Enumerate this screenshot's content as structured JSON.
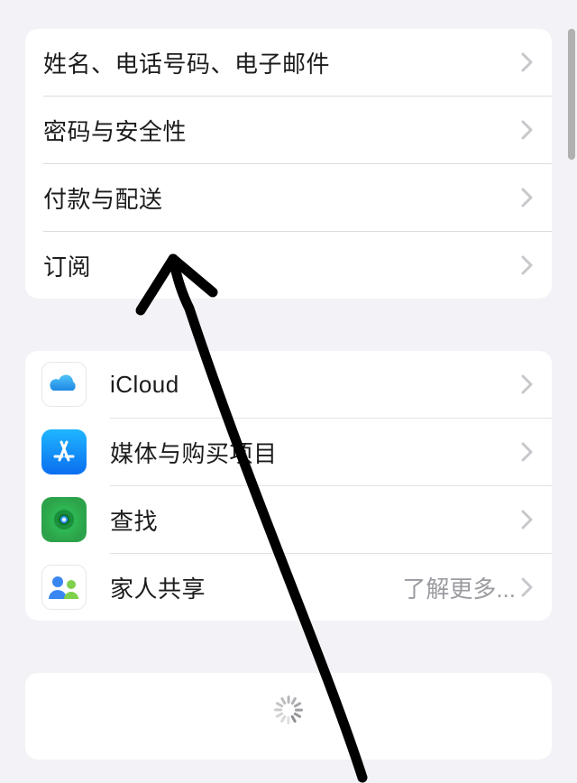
{
  "group1": {
    "items": [
      {
        "label": "姓名、电话号码、电子邮件"
      },
      {
        "label": "密码与安全性"
      },
      {
        "label": "付款与配送"
      },
      {
        "label": "订阅"
      }
    ]
  },
  "group2": {
    "items": [
      {
        "label": "iCloud",
        "icon": "icloud"
      },
      {
        "label": "媒体与购买项目",
        "icon": "appstore"
      },
      {
        "label": "查找",
        "icon": "findmy"
      },
      {
        "label": "家人共享",
        "icon": "family",
        "detail": "了解更多..."
      }
    ]
  }
}
